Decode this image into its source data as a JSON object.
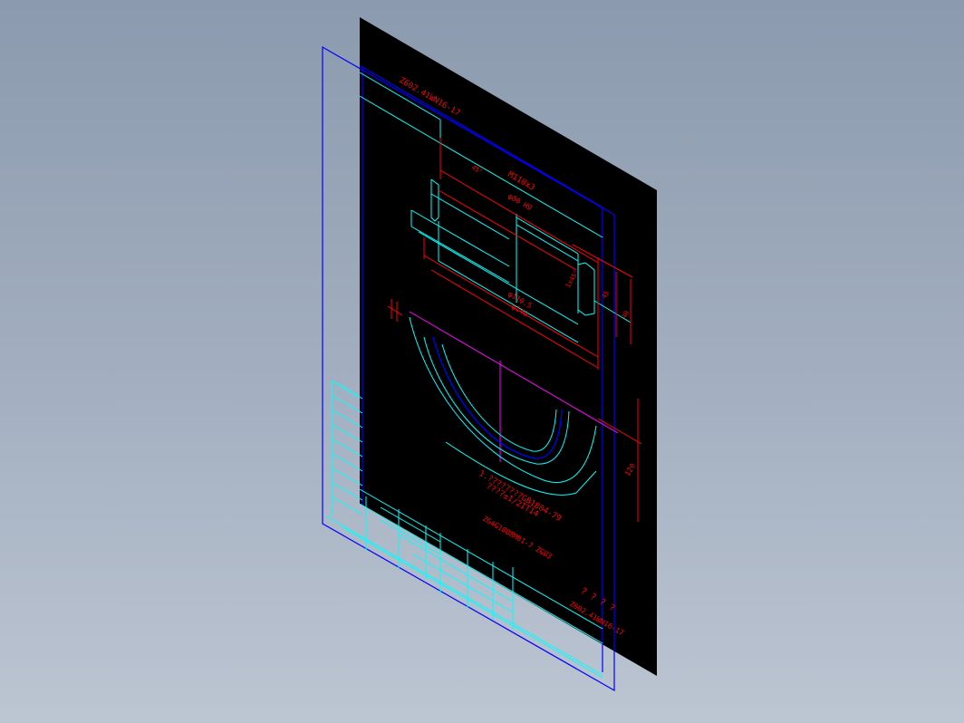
{
  "colors": {
    "background_top": "#8b9aae",
    "background_bottom": "#bcc5d2",
    "sheet": "#000000",
    "frame_blue": "#0000ff",
    "cyan": "#00ffff",
    "red": "#ff0000",
    "magenta": "#ff00ff"
  },
  "drawing": {
    "top_code": "Z602.41WN16-17",
    "dims": {
      "d1": "M110x3",
      "d2": "φ80 H9",
      "d3": "φ110.5",
      "d4": "φ140",
      "d5": "45",
      "d6": "3",
      "d7": "120",
      "d8": "40",
      "chamfer": "1x45°",
      "small_dim": "45°"
    },
    "notes": {
      "line1": "1.????????GB1804-79",
      "line2": "????±1/2IT14",
      "part_code": "ZG4G1008MB1-7  ZG03"
    },
    "title_block": {
      "marks": "? ? ? ?",
      "code": "Z602.41WN16-17",
      "left_labels": "????????"
    }
  }
}
